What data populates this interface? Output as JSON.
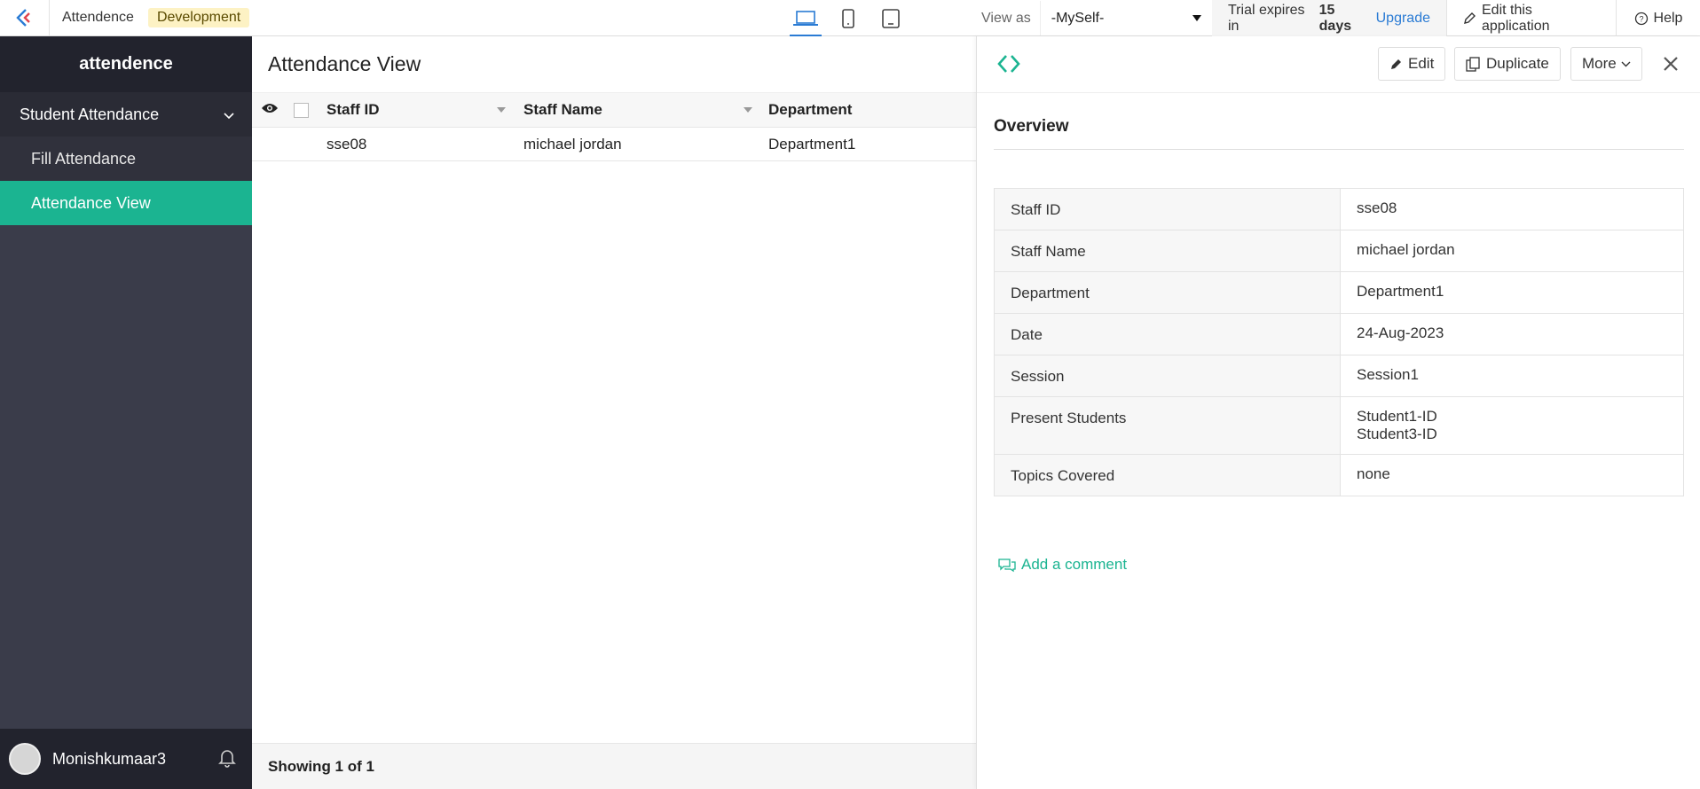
{
  "topbar": {
    "app_name": "Attendence",
    "env_badge": "Development",
    "view_as_label": "View as",
    "view_as_value": "-MySelf-",
    "trial_prefix": "Trial expires in",
    "trial_days": "15 days",
    "upgrade_label": "Upgrade",
    "edit_app_label": "Edit this application",
    "help_label": "Help"
  },
  "sidebar": {
    "app_title": "attendence",
    "section_label": "Student Attendance",
    "items": [
      {
        "label": "Fill Attendance"
      },
      {
        "label": "Attendance View"
      }
    ],
    "user_name": "Monishkumaar3"
  },
  "main": {
    "title": "Attendance View",
    "columns": [
      "Staff ID",
      "Staff Name",
      "Department"
    ],
    "rows": [
      {
        "staff_id": "sse08",
        "staff_name": "michael jordan",
        "department": "Department1"
      }
    ],
    "footer": "Showing 1 of 1"
  },
  "panel": {
    "edit_label": "Edit",
    "duplicate_label": "Duplicate",
    "more_label": "More",
    "overview_title": "Overview",
    "fields": [
      {
        "key": "Staff ID",
        "value": "sse08"
      },
      {
        "key": "Staff Name",
        "value": "michael jordan"
      },
      {
        "key": "Department",
        "value": "Department1"
      },
      {
        "key": "Date",
        "value": "24-Aug-2023"
      },
      {
        "key": "Session",
        "value": "Session1"
      },
      {
        "key": "Present Students",
        "value": "Student1-ID",
        "value2": "Student3-ID"
      },
      {
        "key": "Topics Covered",
        "value": "none"
      }
    ],
    "add_comment_label": "Add a comment"
  },
  "colors": {
    "accent": "#1bb491",
    "link": "#2a7bd4",
    "sidebar_bg": "#3a3c4a"
  }
}
